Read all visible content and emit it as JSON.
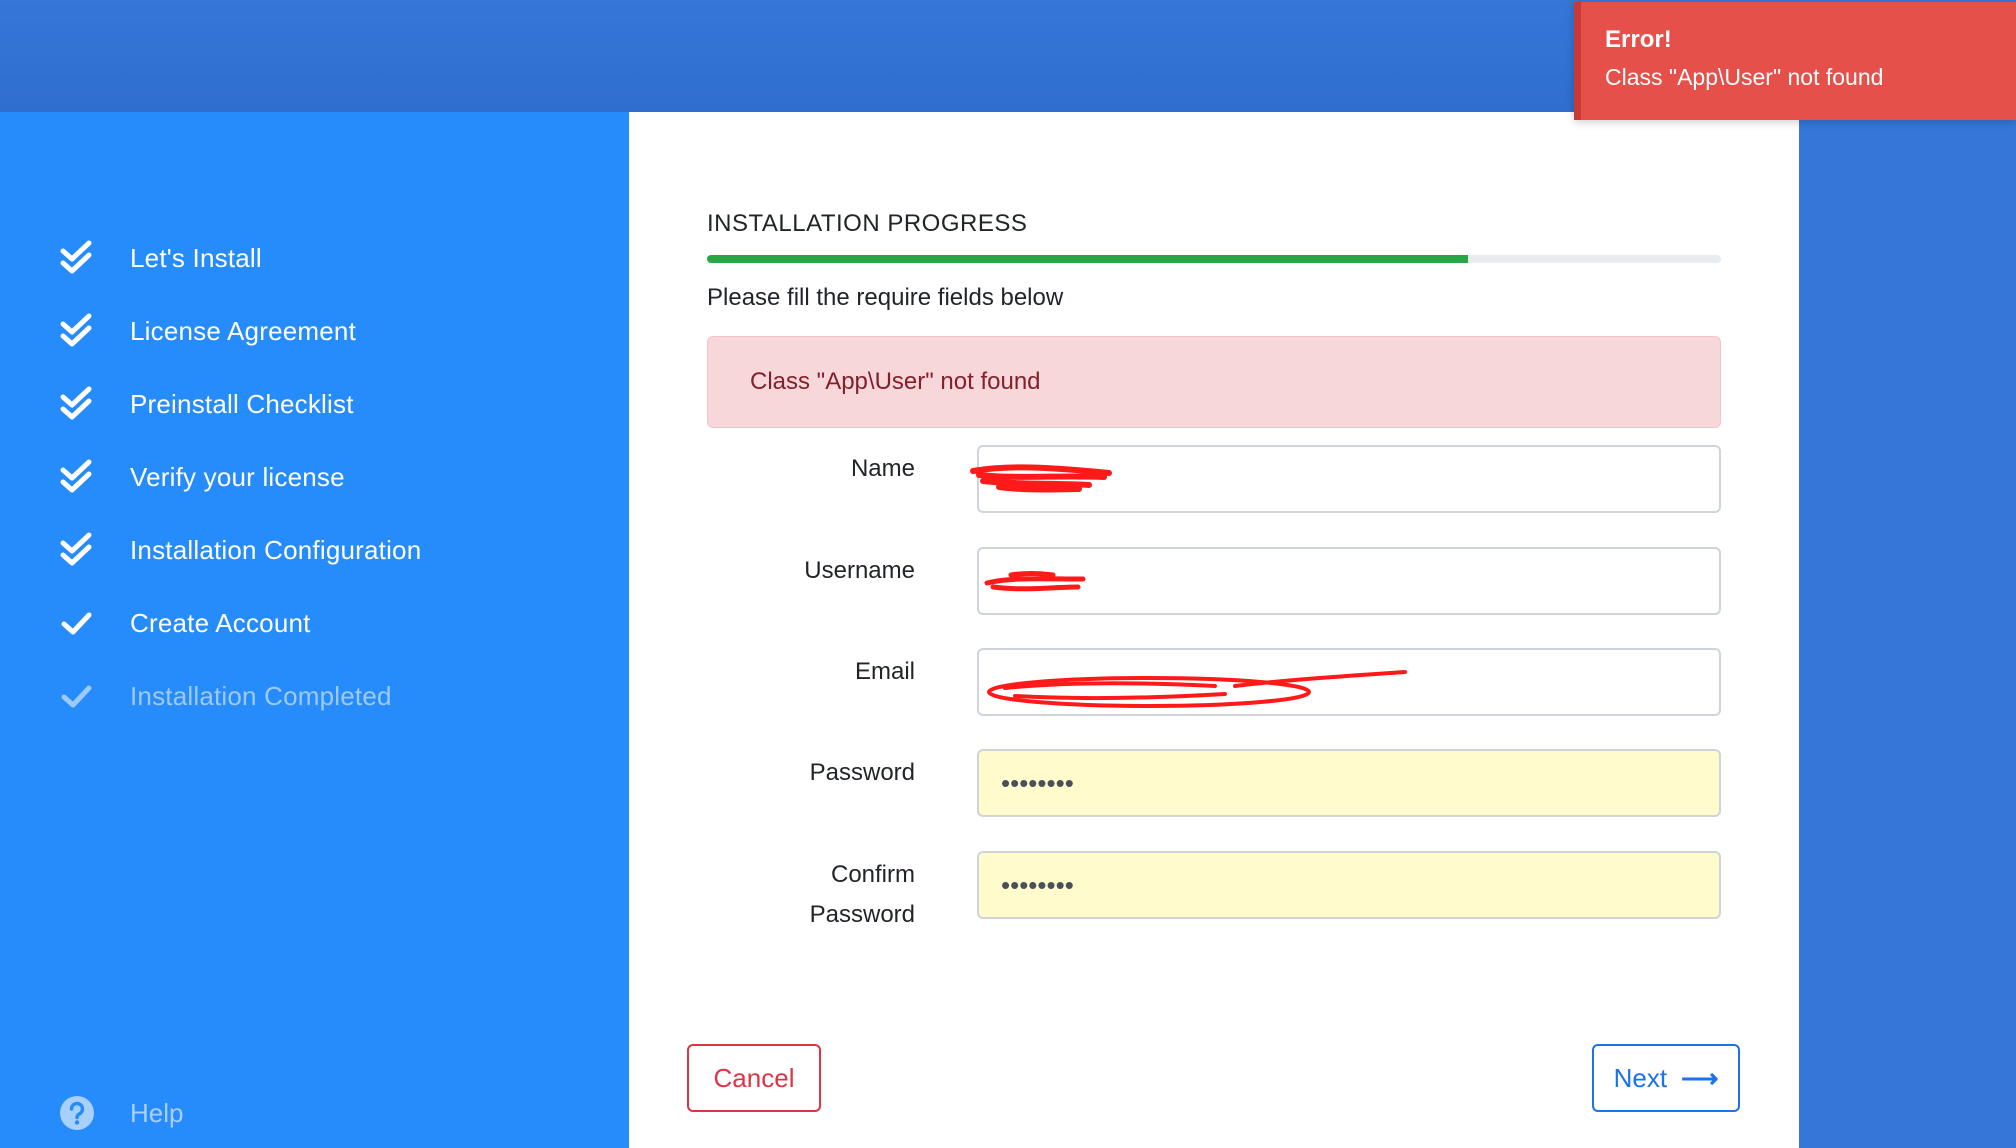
{
  "sidebar": {
    "steps": [
      {
        "label": "Let's Install",
        "status": "done"
      },
      {
        "label": "License Agreement",
        "status": "done"
      },
      {
        "label": "Preinstall Checklist",
        "status": "done"
      },
      {
        "label": "Verify your license",
        "status": "done"
      },
      {
        "label": "Installation Configuration",
        "status": "done"
      },
      {
        "label": "Create Account",
        "status": "current"
      },
      {
        "label": "Installation Completed",
        "status": "pending"
      }
    ],
    "help_label": "Help"
  },
  "main": {
    "title": "INSTALLATION PROGRESS",
    "progress_fraction": 0.75,
    "subtitle": "Please fill the require fields below",
    "alert_message": "Class \"App\\User\" not found",
    "form": {
      "name_label": "Name",
      "username_label": "Username",
      "email_label": "Email",
      "password_label": "Password",
      "password_value": "••••••••",
      "confirm_label_line1": "Confirm",
      "confirm_label_line2": "Password",
      "confirm_value": "••••••••"
    },
    "cancel_label": "Cancel",
    "next_label": "Next",
    "next_arrow": "⟶"
  },
  "toast": {
    "title": "Error!",
    "message": "Class \"App\\User\" not found"
  },
  "colors": {
    "sidebar_bg": "#268bfb",
    "topbar_bg": "#3477d9",
    "progress": "#28a745",
    "alert_bg": "#f8d7da",
    "toast_bg": "#e5504a",
    "cancel": "#dc3545",
    "next": "#1a73e8",
    "autofill_bg": "#fffbcc"
  }
}
